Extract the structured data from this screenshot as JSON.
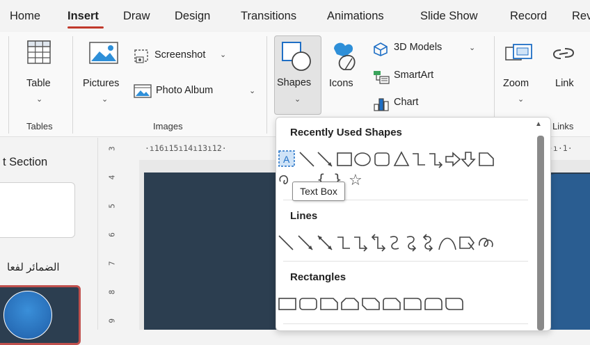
{
  "tabs": {
    "home": "Home",
    "insert": "Insert",
    "draw": "Draw",
    "design": "Design",
    "transitions": "Transitions",
    "animations": "Animations",
    "slideshow": "Slide Show",
    "record": "Record",
    "review_partial": "Rev"
  },
  "ribbon": {
    "table": "Table",
    "tables_group": "Tables",
    "pictures": "Pictures",
    "screenshot": "Screenshot",
    "photo_album": "Photo Album",
    "images_group": "Images",
    "shapes": "Shapes",
    "icons": "Icons",
    "models_3d": "3D Models",
    "smartart": "SmartArt",
    "chart": "Chart",
    "zoom": "Zoom",
    "link": "Link",
    "links_group": "Links"
  },
  "ruler": {
    "top": "·ı16ı15ı14ı13ı12·",
    "top_right": "·ı·1·",
    "left_numbers": "9 8 7 6 5 4 3"
  },
  "slides_panel": {
    "section_label": "t Section",
    "arabic_text": "الضمائر لفعا"
  },
  "shapes_dropdown": {
    "recent_heading": "Recently Used Shapes",
    "lines_heading": "Lines",
    "rectangles_heading": "Rectangles",
    "tooltip": "Text Box"
  },
  "accent": "#c0392b"
}
